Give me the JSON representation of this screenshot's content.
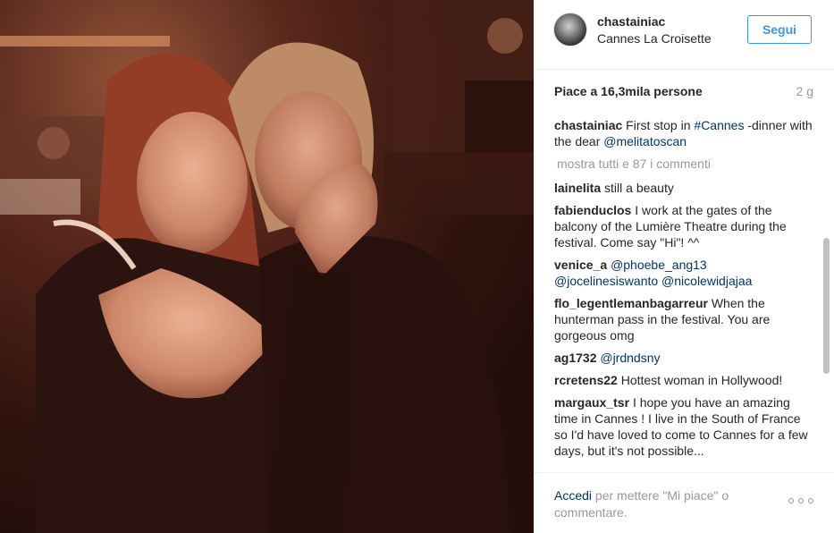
{
  "post": {
    "image_alt": "Two women posing together at a dinner table",
    "username": "chastainiac",
    "location": "Cannes La Croisette",
    "follow_label": "Segui",
    "likes": "Piace a 16,3mila persone",
    "time_ago": "2 g"
  },
  "caption": {
    "user": "chastainiac",
    "text_before": "First stop in ",
    "hashtag": "#Cannes",
    "text_middle": " -dinner with the dear ",
    "mention": "@melitatoscan"
  },
  "show_all_comments": "mostra tutti e 87 i commenti",
  "comments": [
    {
      "user": "lainelita",
      "text": "still a beauty"
    },
    {
      "user": "fabienduclos",
      "text": "I work at the gates of the balcony of the Lumière Theatre during the festival. Come say \"Hi\"! ^^"
    },
    {
      "user": "venice_a",
      "text": "@phoebe_ang13 @jocelinesiswanto @nicolewidjajaa"
    },
    {
      "user": "flo_legentlemanbagarreur",
      "text": "When the hunterman pass in the festival. You are gorgeous omg"
    },
    {
      "user": "ag1732",
      "text": "@jrdndsny"
    },
    {
      "user": "rcretens22",
      "text": "Hottest woman in Hollywood!"
    },
    {
      "user": "margaux_tsr",
      "text": "I hope you have an amazing time in Cannes ! I live in the South of France so I'd have loved to come to Cannes for a few days, but it's not possible..."
    }
  ],
  "footer": {
    "login_label": "Accedi",
    "rest_text": " per mettere \"Mi piace\" o commentare.",
    "more_icon": "ellipsis-icon"
  },
  "colors": {
    "accent": "#3897f0",
    "link": "#003569",
    "muted": "#999999",
    "text": "#262626"
  }
}
